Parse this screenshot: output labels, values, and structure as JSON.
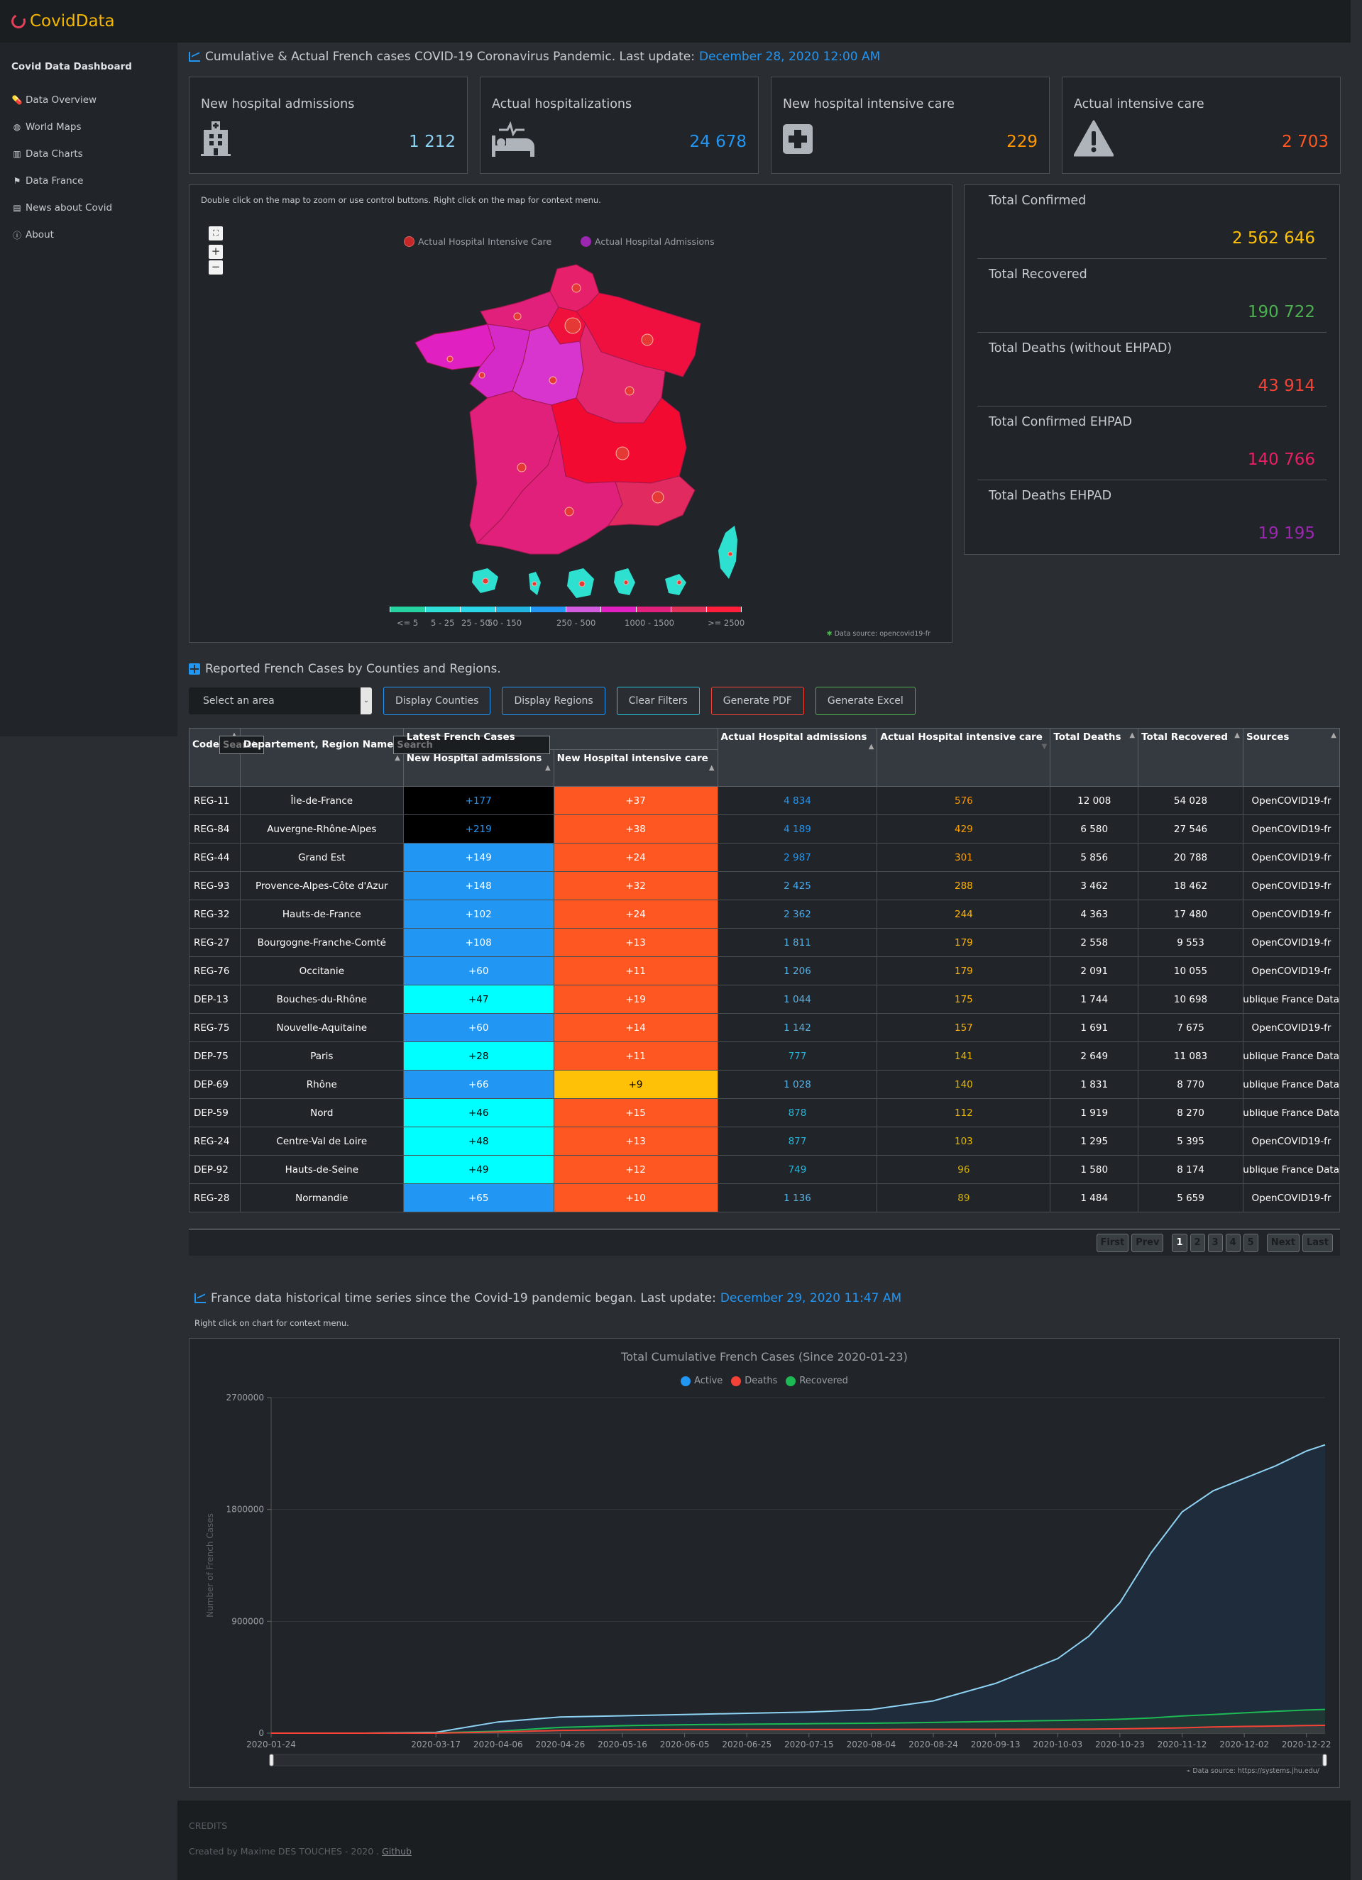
{
  "app": {
    "title": "CovidData",
    "logo_color": "#e8405a",
    "title_color": "#f5b800"
  },
  "sidebar": {
    "title": "Covid Data Dashboard",
    "items": [
      {
        "label": "Data Overview",
        "icon": "pills-icon"
      },
      {
        "label": "World Maps",
        "icon": "globe-icon"
      },
      {
        "label": "Data Charts",
        "icon": "bar-chart-icon"
      },
      {
        "label": "Data France",
        "icon": "flag-icon"
      },
      {
        "label": "News about Covid",
        "icon": "newspaper-icon"
      },
      {
        "label": "About",
        "icon": "info-icon"
      }
    ]
  },
  "overview": {
    "title": "Cumulative & Actual French cases COVID-19 Coronavirus Pandemic. Last update:",
    "last_update": "December 28, 2020 12:00 AM",
    "cards": [
      {
        "label": "New hospital admissions",
        "value": "1 212",
        "icon": "hospital-icon",
        "color": "#8fd3f4"
      },
      {
        "label": "Actual hospitalizations",
        "value": "24 678",
        "icon": "bed-pulse-icon",
        "color": "#2196f3"
      },
      {
        "label": "New hospital intensive care",
        "value": "229",
        "icon": "plus-square-icon",
        "color": "#ff9800"
      },
      {
        "label": "Actual intensive care",
        "value": "2 703",
        "icon": "warning-icon",
        "color": "#ff5722"
      }
    ]
  },
  "map": {
    "hint": "Double click on the map to zoom or use control buttons. Right click on the map for context menu.",
    "controls": {
      "reset": "⛶",
      "zoom_in": "+",
      "zoom_out": "−"
    },
    "legend": [
      {
        "label": "Actual Hospital Intensive Care",
        "color": "#c62828"
      },
      {
        "label": "Actual Hospital Admissions",
        "color": "#9c27b0"
      }
    ],
    "scale_colors": [
      "#26d3a0",
      "#2ee0d8",
      "#2ad6e8",
      "#21b4e0",
      "#2196f3",
      "#d35bdf",
      "#e020c0",
      "#e0207a",
      "#e0305c",
      "#ff1f3a"
    ],
    "scale_labels": [
      "<= 5",
      "5 - 25",
      "25 - 50",
      "50 - 150",
      "250 - 500",
      "1000 - 1500",
      ">= 2500"
    ],
    "source": "Data source: opencovid19-fr"
  },
  "totals": [
    {
      "label": "Total Confirmed",
      "value": "2 562 646",
      "color": "#ffc107"
    },
    {
      "label": "Total Recovered",
      "value": "190 722",
      "color": "#4caf50"
    },
    {
      "label": "Total Deaths (without EHPAD)",
      "value": "43 914",
      "color": "#f44336"
    },
    {
      "label": "Total Confirmed EHPAD",
      "value": "140 766",
      "color": "#e91e63"
    },
    {
      "label": "Total Deaths EHPAD",
      "value": "19 195",
      "color": "#9c27b0"
    }
  ],
  "cases_table": {
    "title": "Reported French Cases by Counties and Regions.",
    "select_placeholder": "Select an area",
    "buttons": [
      {
        "label": "Display Counties",
        "color": "#2196f3"
      },
      {
        "label": "Display Regions",
        "color": "#2196f3"
      },
      {
        "label": "Clear Filters",
        "color": "#26c6da"
      },
      {
        "label": "Generate PDF",
        "color": "#f44336"
      },
      {
        "label": "Generate Excel",
        "color": "#4caf50"
      }
    ],
    "headers": {
      "code": "Code",
      "name": "Departement, Region Name",
      "latest": "Latest French Cases",
      "new_adm": "New Hospital admissions",
      "new_icu": "New Hospital intensive care",
      "act_adm": "Actual Hospital admissions",
      "act_icu": "Actual Hospital intensive care",
      "deaths": "Total Deaths",
      "recovered": "Total Recovered",
      "sources": "Sources"
    },
    "search_placeholder": "Search",
    "rows": [
      {
        "code": "REG-11",
        "name": "Île-de-France",
        "new_adm": "+177",
        "new_icu": "+37",
        "act_adm": "4 834",
        "act_icu": "576",
        "deaths": "12 008",
        "recovered": "54 028",
        "source": "OpenCOVID19-fr",
        "adm_bg": "#000000",
        "adm_fg": "#2196f3",
        "icu_bg": "#ff5722",
        "icu_fg": "#ffffff",
        "act_adm_color": "#2196f3",
        "act_icu_color": "#ff9800"
      },
      {
        "code": "REG-84",
        "name": "Auvergne-Rhône-Alpes",
        "new_adm": "+219",
        "new_icu": "+38",
        "act_adm": "4 189",
        "act_icu": "429",
        "deaths": "6 580",
        "recovered": "27 546",
        "source": "OpenCOVID19-fr",
        "adm_bg": "#000000",
        "adm_fg": "#2196f3",
        "icu_bg": "#ff5722",
        "icu_fg": "#ffffff",
        "act_adm_color": "#2196f3",
        "act_icu_color": "#ffa000"
      },
      {
        "code": "REG-44",
        "name": "Grand Est",
        "new_adm": "+149",
        "new_icu": "+24",
        "act_adm": "2 987",
        "act_icu": "301",
        "deaths": "5 856",
        "recovered": "20 788",
        "source": "OpenCOVID19-fr",
        "adm_bg": "#2196f3",
        "adm_fg": "#ffffff",
        "icu_bg": "#ff5722",
        "icu_fg": "#ffffff",
        "act_adm_color": "#2196f3",
        "act_icu_color": "#ffa000"
      },
      {
        "code": "REG-93",
        "name": "Provence-Alpes-Côte d'Azur",
        "new_adm": "+148",
        "new_icu": "+32",
        "act_adm": "2 425",
        "act_icu": "288",
        "deaths": "3 462",
        "recovered": "18 462",
        "source": "OpenCOVID19-fr",
        "adm_bg": "#2196f3",
        "adm_fg": "#ffffff",
        "icu_bg": "#ff5722",
        "icu_fg": "#ffffff",
        "act_adm_color": "#4aa8e8",
        "act_icu_color": "#ffb300"
      },
      {
        "code": "REG-32",
        "name": "Hauts-de-France",
        "new_adm": "+102",
        "new_icu": "+24",
        "act_adm": "2 362",
        "act_icu": "244",
        "deaths": "4 363",
        "recovered": "17 480",
        "source": "OpenCOVID19-fr",
        "adm_bg": "#2196f3",
        "adm_fg": "#ffffff",
        "icu_bg": "#ff5722",
        "icu_fg": "#ffffff",
        "act_adm_color": "#4aa8e8",
        "act_icu_color": "#ffb300"
      },
      {
        "code": "REG-27",
        "name": "Bourgogne-Franche-Comté",
        "new_adm": "+108",
        "new_icu": "+13",
        "act_adm": "1 811",
        "act_icu": "179",
        "deaths": "2 558",
        "recovered": "9 553",
        "source": "OpenCOVID19-fr",
        "adm_bg": "#2196f3",
        "adm_fg": "#ffffff",
        "icu_bg": "#ff5722",
        "icu_fg": "#ffffff",
        "act_adm_color": "#5ab0e0",
        "act_icu_color": "#ffb300"
      },
      {
        "code": "REG-76",
        "name": "Occitanie",
        "new_adm": "+60",
        "new_icu": "+11",
        "act_adm": "1 206",
        "act_icu": "179",
        "deaths": "2 091",
        "recovered": "10 055",
        "source": "OpenCOVID19-fr",
        "adm_bg": "#2196f3",
        "adm_fg": "#ffffff",
        "icu_bg": "#ff5722",
        "icu_fg": "#ffffff",
        "act_adm_color": "#5ab0e0",
        "act_icu_color": "#ffb300"
      },
      {
        "code": "DEP-13",
        "name": "Bouches-du-Rhône",
        "new_adm": "+47",
        "new_icu": "+19",
        "act_adm": "1 044",
        "act_icu": "175",
        "deaths": "1 744",
        "recovered": "10 698",
        "source": "Santé publique France Data",
        "adm_bg": "#00ffff",
        "adm_fg": "#000000",
        "icu_bg": "#ff5722",
        "icu_fg": "#ffffff",
        "act_adm_color": "#5ab0e0",
        "act_icu_color": "#ffb300"
      },
      {
        "code": "REG-75",
        "name": "Nouvelle-Aquitaine",
        "new_adm": "+60",
        "new_icu": "+14",
        "act_adm": "1 142",
        "act_icu": "157",
        "deaths": "1 691",
        "recovered": "7 675",
        "source": "OpenCOVID19-fr",
        "adm_bg": "#2196f3",
        "adm_fg": "#ffffff",
        "icu_bg": "#ff5722",
        "icu_fg": "#ffffff",
        "act_adm_color": "#5ab0e0",
        "act_icu_color": "#ffb300"
      },
      {
        "code": "DEP-75",
        "name": "Paris",
        "new_adm": "+28",
        "new_icu": "+11",
        "act_adm": "777",
        "act_icu": "141",
        "deaths": "2 649",
        "recovered": "11 083",
        "source": "Santé publique France Data",
        "adm_bg": "#00ffff",
        "adm_fg": "#000000",
        "icu_bg": "#ff5722",
        "icu_fg": "#ffffff",
        "act_adm_color": "#26b5d6",
        "act_icu_color": "#e6b800"
      },
      {
        "code": "DEP-69",
        "name": "Rhône",
        "new_adm": "+66",
        "new_icu": "+9",
        "act_adm": "1 028",
        "act_icu": "140",
        "deaths": "1 831",
        "recovered": "8 770",
        "source": "Santé publique France Data",
        "adm_bg": "#2196f3",
        "adm_fg": "#ffffff",
        "icu_bg": "#ffc107",
        "icu_fg": "#000000",
        "act_adm_color": "#5ab0e0",
        "act_icu_color": "#e6b800"
      },
      {
        "code": "DEP-59",
        "name": "Nord",
        "new_adm": "+46",
        "new_icu": "+15",
        "act_adm": "878",
        "act_icu": "112",
        "deaths": "1 919",
        "recovered": "8 270",
        "source": "Santé publique France Data",
        "adm_bg": "#00ffff",
        "adm_fg": "#000000",
        "icu_bg": "#ff5722",
        "icu_fg": "#ffffff",
        "act_adm_color": "#26b5d6",
        "act_icu_color": "#e6b800"
      },
      {
        "code": "REG-24",
        "name": "Centre-Val de Loire",
        "new_adm": "+48",
        "new_icu": "+13",
        "act_adm": "877",
        "act_icu": "103",
        "deaths": "1 295",
        "recovered": "5 395",
        "source": "OpenCOVID19-fr",
        "adm_bg": "#00ffff",
        "adm_fg": "#000000",
        "icu_bg": "#ff5722",
        "icu_fg": "#ffffff",
        "act_adm_color": "#26b5d6",
        "act_icu_color": "#e6b800"
      },
      {
        "code": "DEP-92",
        "name": "Hauts-de-Seine",
        "new_adm": "+49",
        "new_icu": "+12",
        "act_adm": "749",
        "act_icu": "96",
        "deaths": "1 580",
        "recovered": "8 174",
        "source": "Santé publique France Data",
        "adm_bg": "#00ffff",
        "adm_fg": "#000000",
        "icu_bg": "#ff5722",
        "icu_fg": "#ffffff",
        "act_adm_color": "#26b5d6",
        "act_icu_color": "#d4b000"
      },
      {
        "code": "REG-28",
        "name": "Normandie",
        "new_adm": "+65",
        "new_icu": "+10",
        "act_adm": "1 136",
        "act_icu": "89",
        "deaths": "1 484",
        "recovered": "5 659",
        "source": "OpenCOVID19-fr",
        "adm_bg": "#2196f3",
        "adm_fg": "#ffffff",
        "icu_bg": "#ff5722",
        "icu_fg": "#ffffff",
        "act_adm_color": "#5ab0e0",
        "act_icu_color": "#d4b000"
      }
    ],
    "pagination": {
      "first": "First",
      "prev": "Prev",
      "pages": [
        "1",
        "2",
        "3",
        "4",
        "5"
      ],
      "current": "1",
      "next": "Next",
      "last": "Last"
    }
  },
  "history": {
    "title": "France data historical time series since the Covid-19 pandemic began. Last update:",
    "last_update": "December 29, 2020 11:47 AM",
    "hint": "Right click on chart for context menu.",
    "source": "Data source: https://systems.jhu.edu/"
  },
  "chart_data": {
    "type": "area",
    "title": "Total Cumulative French Cases (Since 2020-01-23)",
    "xlabel": "",
    "ylabel": "Number of French Cases",
    "ylim": [
      0,
      2700000
    ],
    "yticks": [
      0,
      900000,
      1800000,
      2700000
    ],
    "xticks": [
      "2020-01-24",
      "2020-03-17",
      "2020-04-06",
      "2020-04-26",
      "2020-05-16",
      "2020-06-05",
      "2020-06-25",
      "2020-07-15",
      "2020-08-04",
      "2020-08-24",
      "2020-09-13",
      "2020-10-03",
      "2020-10-23",
      "2020-11-12",
      "2020-12-02",
      "2020-12-22"
    ],
    "legend_position": "top-center",
    "grid": true,
    "x": [
      "2020-01-24",
      "2020-02-23",
      "2020-03-17",
      "2020-04-06",
      "2020-04-26",
      "2020-05-16",
      "2020-06-05",
      "2020-06-25",
      "2020-07-15",
      "2020-08-04",
      "2020-08-24",
      "2020-09-13",
      "2020-10-03",
      "2020-10-13",
      "2020-10-23",
      "2020-11-02",
      "2020-11-12",
      "2020-11-22",
      "2020-12-02",
      "2020-12-12",
      "2020-12-22",
      "2020-12-28"
    ],
    "series": [
      {
        "name": "Active",
        "color": "#8fd3f4",
        "legend_color": "#2196f3",
        "values": [
          0,
          20,
          6500,
          90000,
          130000,
          140000,
          150000,
          160000,
          170000,
          190000,
          260000,
          400000,
          600000,
          780000,
          1050000,
          1450000,
          1780000,
          1950000,
          2050000,
          2150000,
          2270000,
          2320000
        ]
      },
      {
        "name": "Deaths",
        "color": "#f44336",
        "legend_color": "#f44336",
        "values": [
          0,
          1,
          200,
          8900,
          22000,
          27000,
          29000,
          29800,
          30100,
          30300,
          30600,
          31000,
          32000,
          33000,
          35000,
          38000,
          43000,
          50000,
          54000,
          57000,
          61000,
          63000
        ]
      },
      {
        "name": "Recovered",
        "color": "#1db954",
        "legend_color": "#1db954",
        "values": [
          0,
          12,
          2200,
          16000,
          46000,
          60000,
          68000,
          72000,
          76000,
          80000,
          86000,
          95000,
          102000,
          106000,
          112000,
          122000,
          138000,
          150000,
          163000,
          175000,
          186000,
          190722
        ]
      }
    ]
  },
  "footer": {
    "credits": "CREDITS",
    "created": "Created by Maxime DES TOUCHES - 2020 .",
    "github": "Github"
  }
}
